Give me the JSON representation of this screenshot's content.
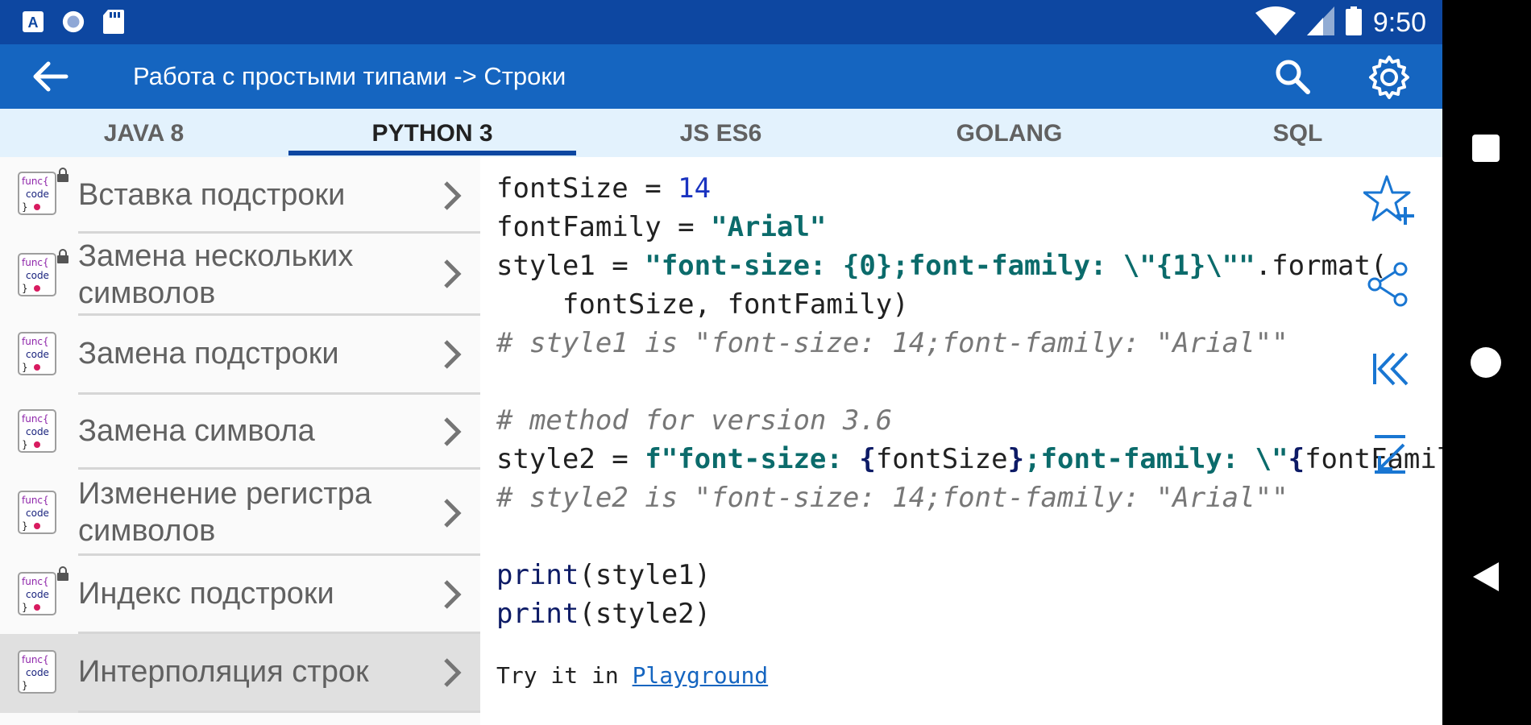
{
  "status": {
    "time": "9:50"
  },
  "app_bar": {
    "title": "Работа с простыми типами -> Строки"
  },
  "tabs": [
    {
      "label": "JAVA 8",
      "active": false
    },
    {
      "label": "PYTHON 3",
      "active": true
    },
    {
      "label": "JS ES6",
      "active": false
    },
    {
      "label": "GOLANG",
      "active": false
    },
    {
      "label": "SQL",
      "active": false
    }
  ],
  "icon_text": {
    "func": "func{",
    "code": "code",
    "close": "}"
  },
  "list": [
    {
      "label": "Вставка подстроки",
      "locked": true,
      "selected": false
    },
    {
      "label": "Замена нескольких символов",
      "locked": true,
      "selected": false
    },
    {
      "label": "Замена подстроки",
      "locked": false,
      "selected": false
    },
    {
      "label": "Замена символа",
      "locked": false,
      "selected": false
    },
    {
      "label": "Изменение регистра символов",
      "locked": false,
      "selected": false
    },
    {
      "label": "Индекс подстроки",
      "locked": true,
      "selected": false
    },
    {
      "label": "Интерполяция строк",
      "locked": false,
      "selected": true
    }
  ],
  "code": {
    "l1_a": "fontSize = ",
    "l1_b": "14",
    "l2_a": "fontFamily = ",
    "l2_b": "\"Arial\"",
    "l3_a": "style1 = ",
    "l3_b": "\"font-size: {0};font-family: \\\"{1}\\\"\"",
    "l3_c": ".format(",
    "l4": "    fontSize, fontFamily)",
    "l5": "# style1 is \"font-size: 14;font-family: \"Arial\"\"",
    "l6": "# method for version 3.6",
    "l7_a": "style2 = ",
    "l7_b": "f\"font-size: ",
    "l7_c": "{",
    "l7_d": "fontSize",
    "l7_e": "}",
    "l7_f": ";font-family: \\\"",
    "l7_g": "{",
    "l7_h": "fontFamily",
    "l8": "# style2 is \"font-size: 14;font-family: \"Arial\"\"",
    "l9_a": "print",
    "l9_b": "(style1)",
    "l10_a": "print",
    "l10_b": "(style2)"
  },
  "footer": {
    "try_text": "Try it in ",
    "link": "Playground"
  },
  "colors": {
    "status_bar": "#0d47a1",
    "app_bar": "#1565c0",
    "tabs_bg": "#e3f2fd",
    "accent": "#1565c0"
  },
  "side_actions": [
    "star-plus-icon",
    "share-icon",
    "first-page-icon",
    "collapse-down-icon"
  ]
}
